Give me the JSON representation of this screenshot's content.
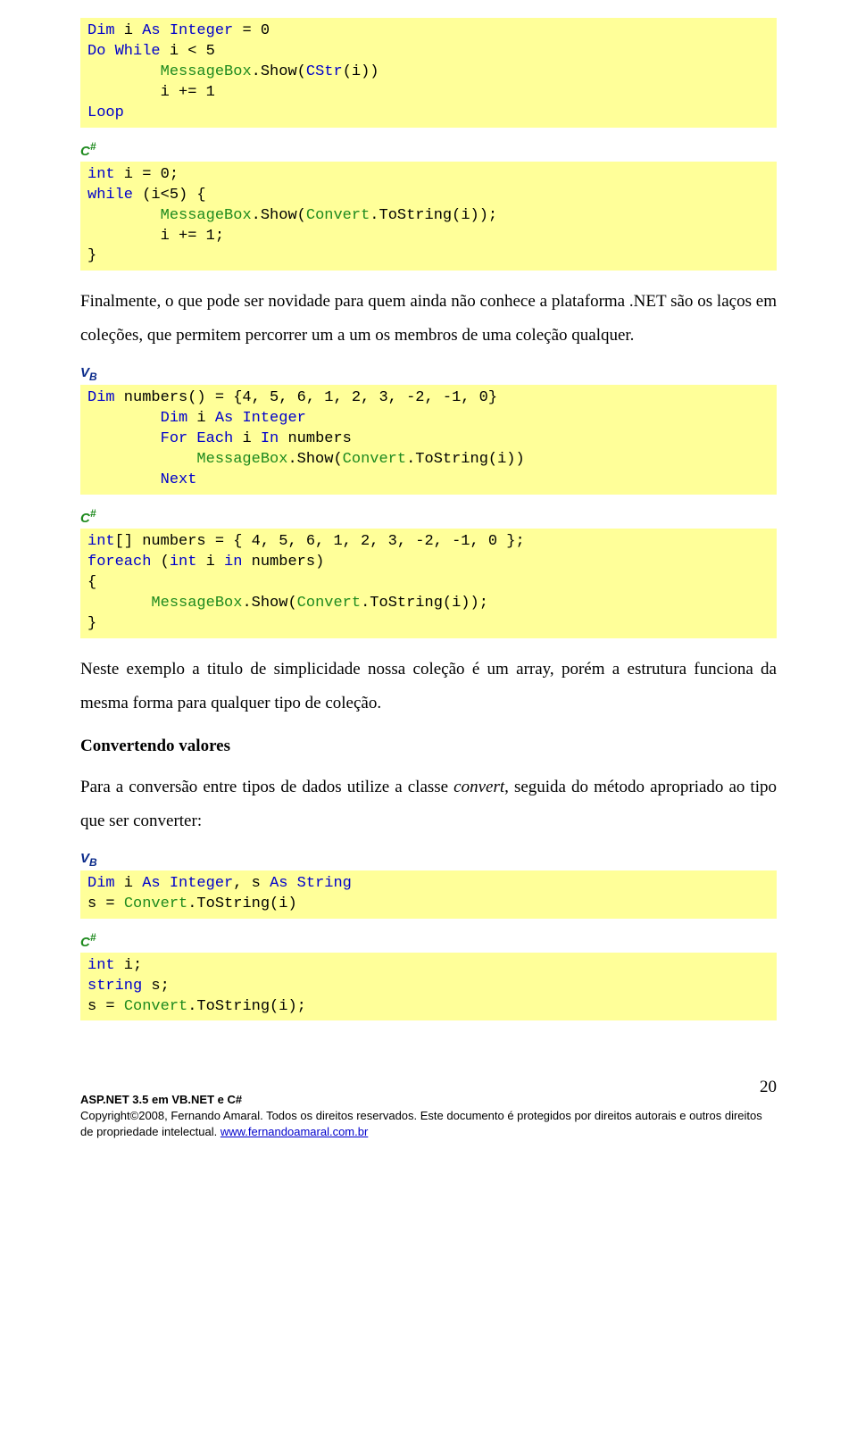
{
  "icons": {
    "vb_v": "V",
    "vb_b": "B",
    "cs_c": "C",
    "cs_hash": "#"
  },
  "code1": {
    "l1a": "Dim",
    "l1b": " i ",
    "l1c": "As Integer",
    "l1d": " = 0",
    "l2a": "Do While",
    "l2b": " i < 5",
    "l3a": "        ",
    "l3b": "MessageBox",
    "l3c": ".Show(",
    "l3d": "CStr",
    "l3e": "(i))",
    "l4": "        i += 1",
    "l5": "Loop"
  },
  "code2": {
    "l1a": "int",
    "l1b": " i = 0;",
    "l2a": "while",
    "l2b": " (i<5) {",
    "l3a": "        ",
    "l3b": "MessageBox",
    "l3c": ".Show(",
    "l3d": "Convert",
    "l3e": ".ToString(i));",
    "l4": "        i += 1;",
    "l5": "}"
  },
  "para1": "Finalmente, o que pode ser novidade para quem ainda não conhece a plataforma .NET são os laços em coleções, que permitem percorrer um a um os membros de uma coleção qualquer.",
  "code3": {
    "l1a": "Dim",
    "l1b": " numbers() = {4, 5, 6, 1, 2, 3, -2, -1, 0}",
    "l2a": "        ",
    "l2b": "Dim",
    "l2c": " i ",
    "l2d": "As Integer",
    "l3a": "        ",
    "l3b": "For Each",
    "l3c": " i ",
    "l3d": "In",
    "l3e": " numbers",
    "l4a": "            ",
    "l4b": "MessageBox",
    "l4c": ".Show(",
    "l4d": "Convert",
    "l4e": ".ToString(i))",
    "l5a": "        ",
    "l5b": "Next"
  },
  "code4": {
    "l1a": "int",
    "l1b": "[] numbers = { 4, 5, 6, 1, 2, 3, -2, -1, 0 };",
    "l2a": "foreach",
    "l2b": " (",
    "l2c": "int",
    "l2d": " i ",
    "l2e": "in",
    "l2f": " numbers)",
    "l3": "{",
    "l4a": "       ",
    "l4b": "MessageBox",
    "l4c": ".Show(",
    "l4d": "Convert",
    "l4e": ".ToString(i));",
    "l5": "}"
  },
  "para2": "Neste exemplo a titulo de simplicidade nossa coleção é um array, porém a estrutura funciona da mesma forma para qualquer tipo de coleção.",
  "heading1": "Convertendo valores",
  "para3_a": "Para a conversão entre tipos de dados utilize a classe ",
  "para3_i1": "convert",
  "para3_b": ", seguida do método apropriado ao tipo que ser converter:",
  "code5": {
    "l1a": "Dim",
    "l1b": " i ",
    "l1c": "As Integer",
    "l1d": ", s ",
    "l1e": "As String",
    "l2a": "s = ",
    "l2b": "Convert",
    "l2c": ".ToString(i)"
  },
  "code6": {
    "l1a": "int",
    "l1b": " i;",
    "l2a": "string",
    "l2b": " s;",
    "l3a": "s = ",
    "l3b": "Convert",
    "l3c": ".ToString(i);"
  },
  "footer": {
    "pagenum": "20",
    "line1": "ASP.NET 3.5 em VB.NET e C#",
    "line2a": "Copyright©2008,  Fernando Amaral. Todos os direitos reservados. Este documento é protegidos por direitos autorais e outros direitos de propriedade intelectual. ",
    "link": "www.fernandoamaral.com.br"
  }
}
